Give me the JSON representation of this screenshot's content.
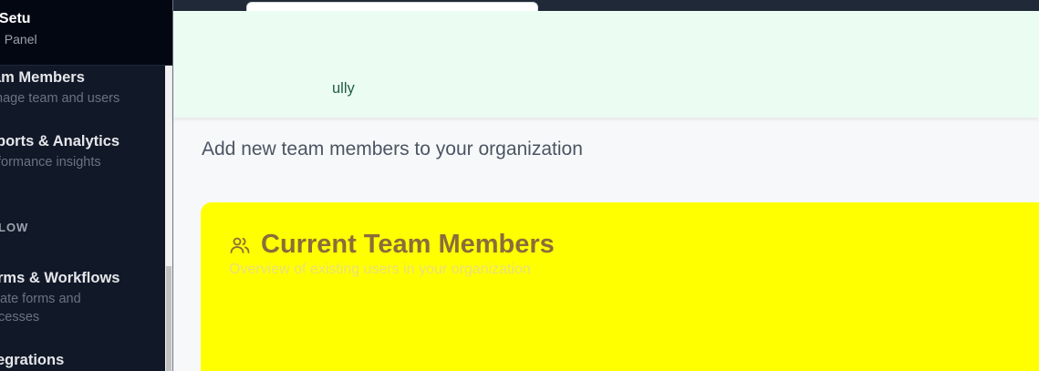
{
  "brand": {
    "name": "kSetu",
    "subtitle": "in Panel"
  },
  "sidebar": {
    "items": [
      {
        "title": "am Members",
        "desc": "nage team and users"
      },
      {
        "title": "ports & Analytics",
        "desc": "formance insights"
      },
      {
        "section": "LOW"
      },
      {
        "title": "rms & Workflows",
        "desc1": "ate forms and",
        "desc2": "cesses"
      },
      {
        "title": "egrations"
      }
    ]
  },
  "banner": {
    "text": "ully"
  },
  "main": {
    "subtitle": "Add new team members to your organization",
    "card": {
      "title": "Current Team Members",
      "description": "Overview of existing users in your organization",
      "icon": "users-icon"
    }
  },
  "colors": {
    "sidebar_bg": "#111827",
    "banner_bg": "#ebfcf3",
    "card_bg": "#ffff00",
    "card_title": "#8a6d3b"
  }
}
